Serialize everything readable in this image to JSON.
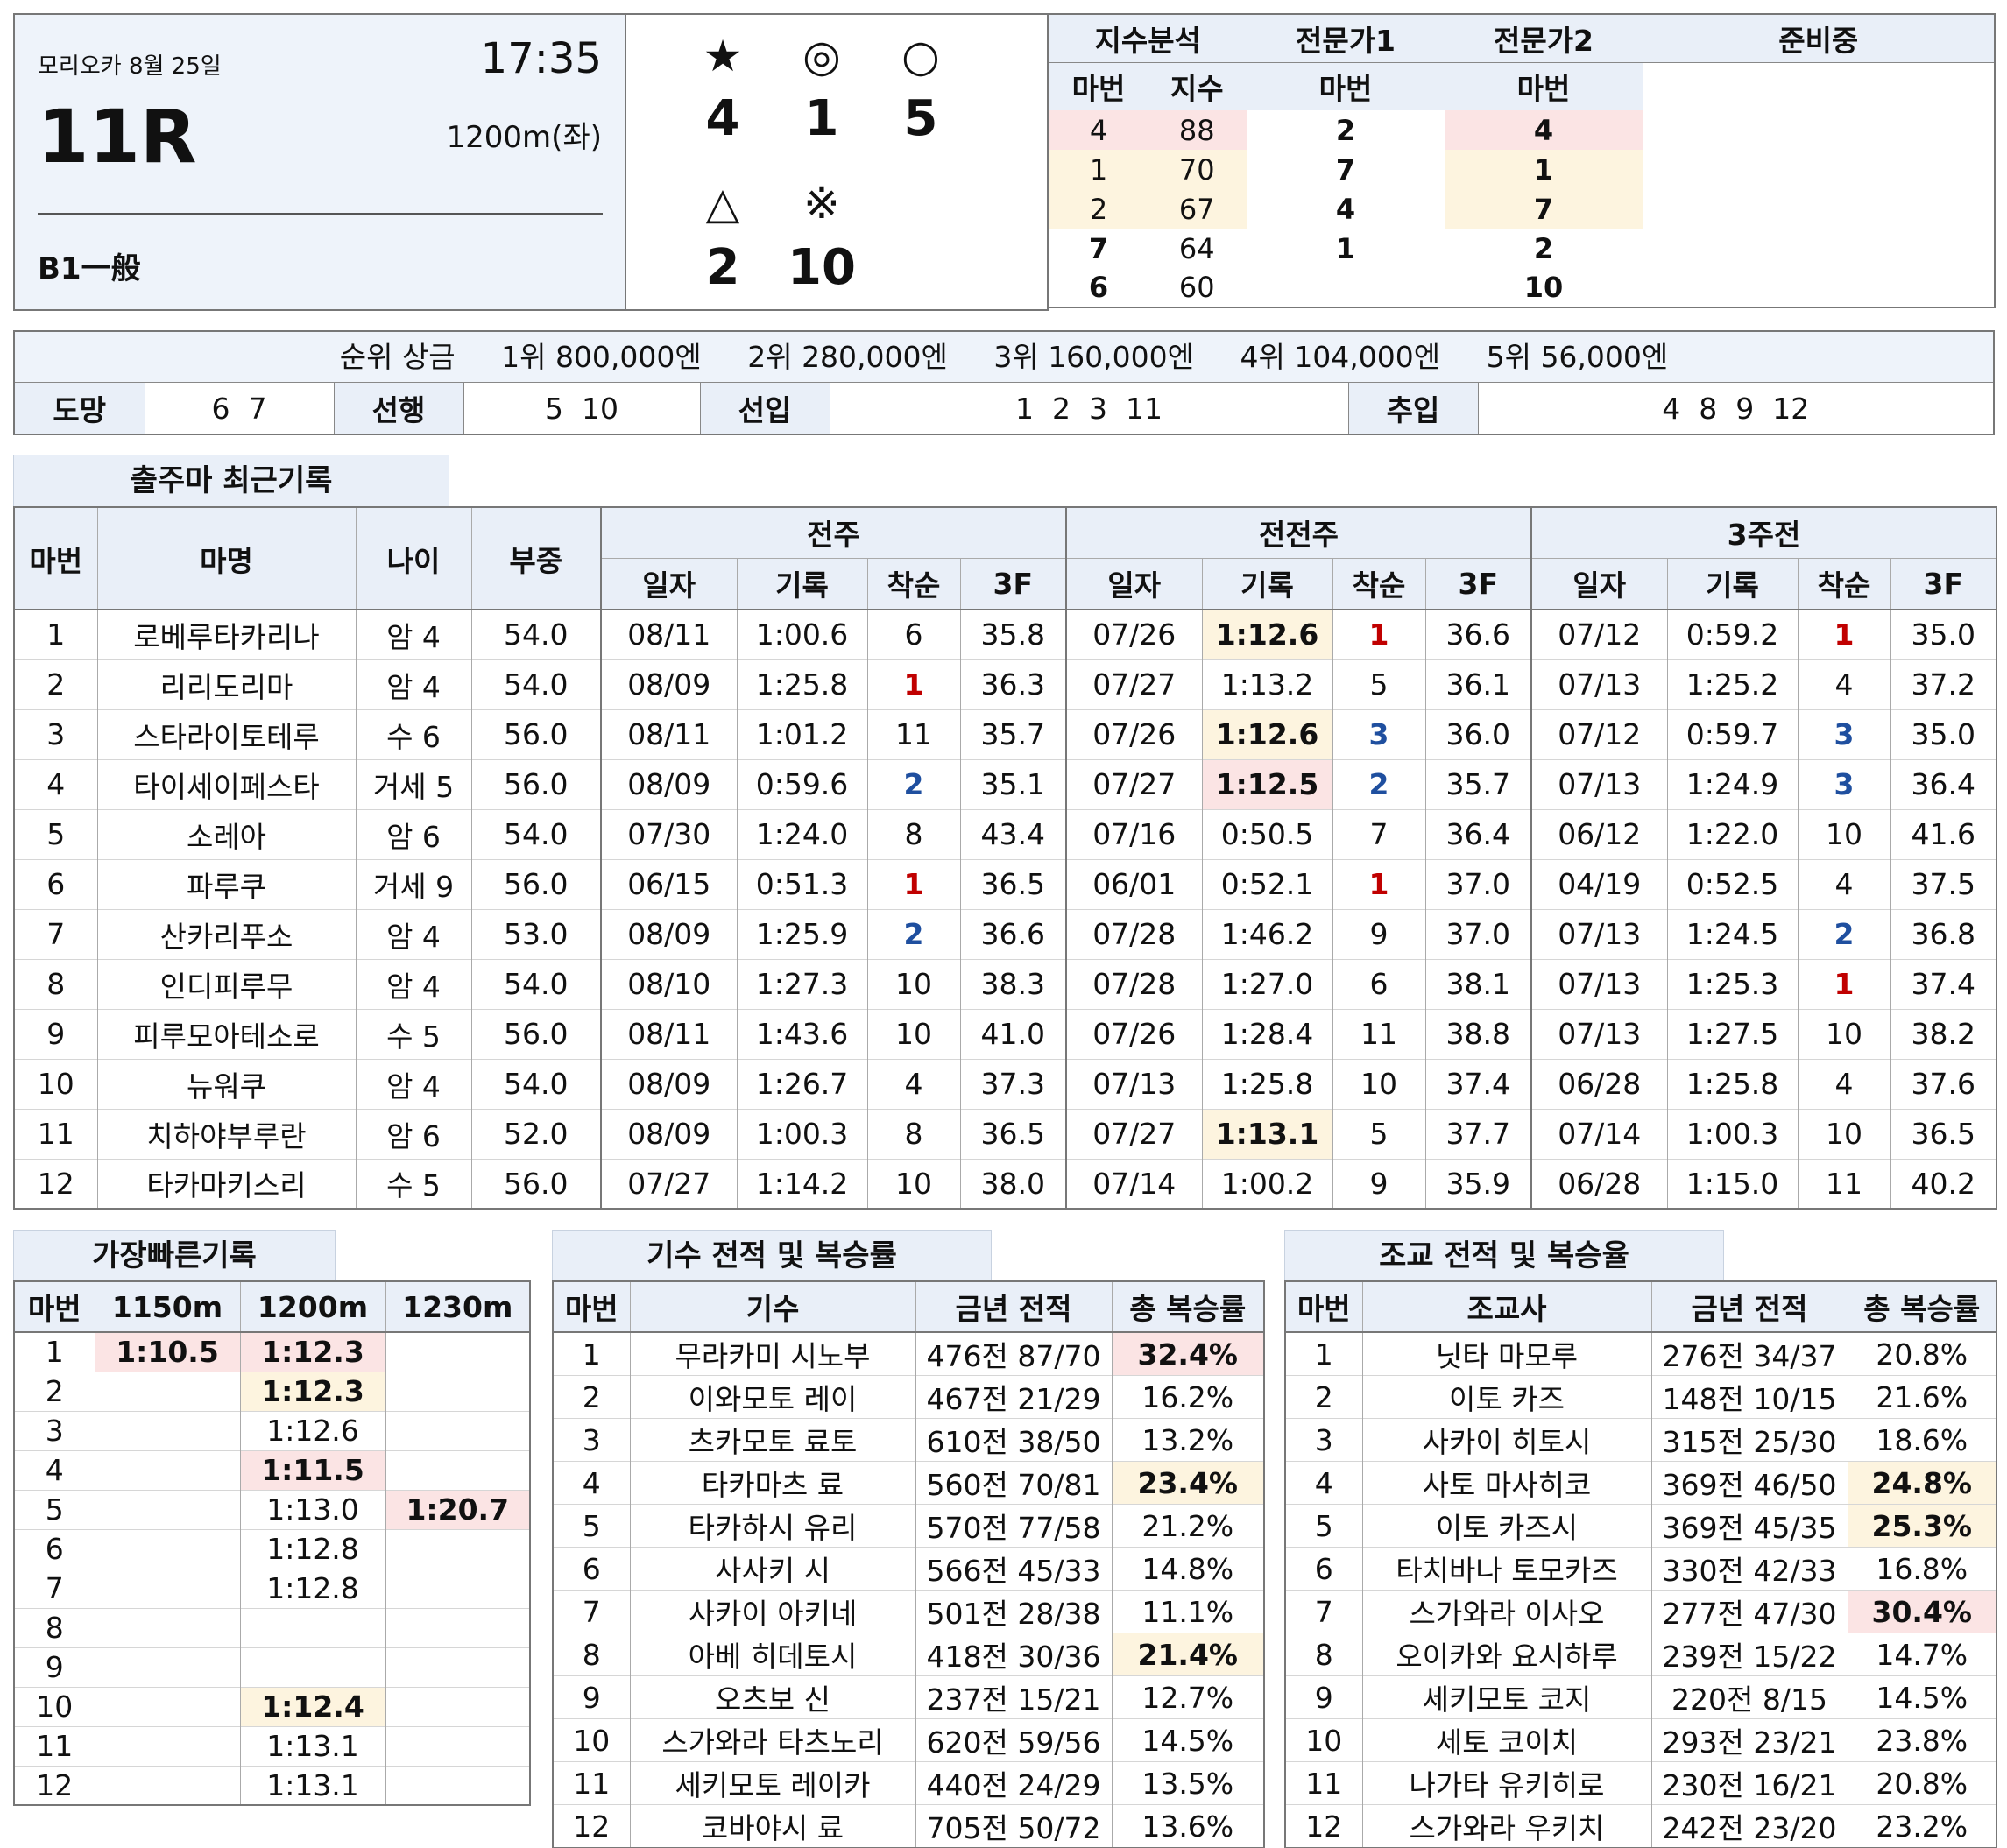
{
  "race": {
    "venue_date": "모리오카 8월 25일",
    "time": "17:35",
    "number": "11R",
    "distance": "1200m(좌)",
    "class": "B1一般"
  },
  "prediction": {
    "symbols": [
      "★",
      "◎",
      "○",
      "△",
      "※"
    ],
    "numbers": [
      "4",
      "1",
      "5",
      "2",
      "10"
    ]
  },
  "index_panel": {
    "headers": {
      "index_analysis": "지수분석",
      "expert1": "전문가1",
      "expert2": "전문가2",
      "preparing": "준비중"
    },
    "subheaders": {
      "horse_no": "마번",
      "index": "지수",
      "expert1_no": "마번",
      "expert2_no": "마번"
    },
    "rows": [
      {
        "no": "4",
        "idx": "88",
        "e1": "2",
        "e2": "4"
      },
      {
        "no": "1",
        "idx": "70",
        "e1": "7",
        "e2": "1"
      },
      {
        "no": "2",
        "idx": "67",
        "e1": "4",
        "e2": "7"
      },
      {
        "no": "7",
        "idx": "64",
        "e1": "1",
        "e2": "2"
      },
      {
        "no": "6",
        "idx": "60",
        "e1": "",
        "e2": "10"
      }
    ]
  },
  "prize": {
    "label": "순위 상금",
    "items": [
      "1위 800,000엔",
      "2위 280,000엔",
      "3위 160,000엔",
      "4위 104,000엔",
      "5위 56,000엔"
    ]
  },
  "running_style": {
    "escape_label": "도망",
    "escape": "6  7",
    "front_label": "선행",
    "front": "5  10",
    "stalker_label": "선입",
    "stalker": "1  2  3  11",
    "closer_label": "추입",
    "closer": "4  8  9  12"
  },
  "recent": {
    "title": "출주마 최근기록",
    "col_no": "마번",
    "col_name": "마명",
    "col_age": "나이",
    "col_weight": "부중",
    "groups": [
      "전주",
      "전전주",
      "3주전"
    ],
    "sub": [
      "일자",
      "기록",
      "착순",
      "3F"
    ],
    "rows": [
      {
        "no": "1",
        "name": "로베루타카리나",
        "age": "암 4",
        "wt": "54.0",
        "r": [
          [
            "08/11",
            "1:00.6",
            "6",
            "35.8"
          ],
          [
            "07/26",
            "1:12.6",
            "1",
            "36.6"
          ],
          [
            "07/12",
            "0:59.2",
            "1",
            "35.0"
          ]
        ]
      },
      {
        "no": "2",
        "name": "리리도리마",
        "age": "암 4",
        "wt": "54.0",
        "r": [
          [
            "08/09",
            "1:25.8",
            "1",
            "36.3"
          ],
          [
            "07/27",
            "1:13.2",
            "5",
            "36.1"
          ],
          [
            "07/13",
            "1:25.2",
            "4",
            "37.2"
          ]
        ]
      },
      {
        "no": "3",
        "name": "스타라이토테루",
        "age": "수 6",
        "wt": "56.0",
        "r": [
          [
            "08/11",
            "1:01.2",
            "11",
            "35.7"
          ],
          [
            "07/26",
            "1:12.6",
            "3",
            "36.0"
          ],
          [
            "07/12",
            "0:59.7",
            "3",
            "35.0"
          ]
        ]
      },
      {
        "no": "4",
        "name": "타이세이페스타",
        "age": "거세 5",
        "wt": "56.0",
        "r": [
          [
            "08/09",
            "0:59.6",
            "2",
            "35.1"
          ],
          [
            "07/27",
            "1:12.5",
            "2",
            "35.7"
          ],
          [
            "07/13",
            "1:24.9",
            "3",
            "36.4"
          ]
        ]
      },
      {
        "no": "5",
        "name": "소레아",
        "age": "암 6",
        "wt": "54.0",
        "r": [
          [
            "07/30",
            "1:24.0",
            "8",
            "43.4"
          ],
          [
            "07/16",
            "0:50.5",
            "7",
            "36.4"
          ],
          [
            "06/12",
            "1:22.0",
            "10",
            "41.6"
          ]
        ]
      },
      {
        "no": "6",
        "name": "파루쿠",
        "age": "거세 9",
        "wt": "56.0",
        "r": [
          [
            "06/15",
            "0:51.3",
            "1",
            "36.5"
          ],
          [
            "06/01",
            "0:52.1",
            "1",
            "37.0"
          ],
          [
            "04/19",
            "0:52.5",
            "4",
            "37.5"
          ]
        ]
      },
      {
        "no": "7",
        "name": "산카리푸소",
        "age": "암 4",
        "wt": "53.0",
        "r": [
          [
            "08/09",
            "1:25.9",
            "2",
            "36.6"
          ],
          [
            "07/28",
            "1:46.2",
            "9",
            "37.0"
          ],
          [
            "07/13",
            "1:24.5",
            "2",
            "36.8"
          ]
        ]
      },
      {
        "no": "8",
        "name": "인디피루무",
        "age": "암 4",
        "wt": "54.0",
        "r": [
          [
            "08/10",
            "1:27.3",
            "10",
            "38.3"
          ],
          [
            "07/28",
            "1:27.0",
            "6",
            "38.1"
          ],
          [
            "07/13",
            "1:25.3",
            "1",
            "37.4"
          ]
        ]
      },
      {
        "no": "9",
        "name": "피루모아테소로",
        "age": "수 5",
        "wt": "56.0",
        "r": [
          [
            "08/11",
            "1:43.6",
            "10",
            "41.0"
          ],
          [
            "07/26",
            "1:28.4",
            "11",
            "38.8"
          ],
          [
            "07/13",
            "1:27.5",
            "10",
            "38.2"
          ]
        ]
      },
      {
        "no": "10",
        "name": "뉴워쿠",
        "age": "암 4",
        "wt": "54.0",
        "r": [
          [
            "08/09",
            "1:26.7",
            "4",
            "37.3"
          ],
          [
            "07/13",
            "1:25.8",
            "10",
            "37.4"
          ],
          [
            "06/28",
            "1:25.8",
            "4",
            "37.6"
          ]
        ]
      },
      {
        "no": "11",
        "name": "치하야부루란",
        "age": "암 6",
        "wt": "52.0",
        "r": [
          [
            "08/09",
            "1:00.3",
            "8",
            "36.5"
          ],
          [
            "07/27",
            "1:13.1",
            "5",
            "37.7"
          ],
          [
            "07/14",
            "1:00.3",
            "10",
            "36.5"
          ]
        ]
      },
      {
        "no": "12",
        "name": "타카마키스리",
        "age": "수 5",
        "wt": "56.0",
        "r": [
          [
            "07/27",
            "1:14.2",
            "10",
            "38.0"
          ],
          [
            "07/14",
            "1:00.2",
            "9",
            "35.9"
          ],
          [
            "06/28",
            "1:15.0",
            "11",
            "40.2"
          ]
        ]
      }
    ]
  },
  "fastest": {
    "title": "가장빠른기록",
    "headers": [
      "마번",
      "1150m",
      "1200m",
      "1230m"
    ],
    "rows": [
      [
        "1",
        "1:10.5",
        "1:12.3",
        ""
      ],
      [
        "2",
        "",
        "1:12.3",
        ""
      ],
      [
        "3",
        "",
        "1:12.6",
        ""
      ],
      [
        "4",
        "",
        "1:11.5",
        ""
      ],
      [
        "5",
        "",
        "1:13.0",
        "1:20.7"
      ],
      [
        "6",
        "",
        "1:12.8",
        ""
      ],
      [
        "7",
        "",
        "1:12.8",
        ""
      ],
      [
        "8",
        "",
        "",
        ""
      ],
      [
        "9",
        "",
        "",
        ""
      ],
      [
        "10",
        "",
        "1:12.4",
        ""
      ],
      [
        "11",
        "",
        "1:13.1",
        ""
      ],
      [
        "12",
        "",
        "1:13.1",
        ""
      ]
    ]
  },
  "jockey": {
    "title": "기수 전적 및 복승률",
    "headers": [
      "마번",
      "기수",
      "금년 전적",
      "총 복승률"
    ],
    "rows": [
      [
        "1",
        "무라카미 시노부",
        "476전 87/70",
        "32.4%"
      ],
      [
        "2",
        "이와모토 레이",
        "467전 21/29",
        "16.2%"
      ],
      [
        "3",
        "츠카모토 료토",
        "610전 38/50",
        "13.2%"
      ],
      [
        "4",
        "타카마츠 료",
        "560전 70/81",
        "23.4%"
      ],
      [
        "5",
        "타카하시 유리",
        "570전 77/58",
        "21.2%"
      ],
      [
        "6",
        "사사키 시",
        "566전 45/33",
        "14.8%"
      ],
      [
        "7",
        "사카이 아키네",
        "501전 28/38",
        "11.1%"
      ],
      [
        "8",
        "아베 히데토시",
        "418전 30/36",
        "21.4%"
      ],
      [
        "9",
        "오츠보 신",
        "237전 15/21",
        "12.7%"
      ],
      [
        "10",
        "스가와라 타츠노리",
        "620전 59/56",
        "14.5%"
      ],
      [
        "11",
        "세키모토 레이카",
        "440전 24/29",
        "13.5%"
      ],
      [
        "12",
        "코바야시 료",
        "705전 50/72",
        "13.6%"
      ]
    ]
  },
  "trainer": {
    "title": "조교 전적 및 복승율",
    "headers": [
      "마번",
      "조교사",
      "금년 전적",
      "총 복승률"
    ],
    "rows": [
      [
        "1",
        "닛타 마모루",
        "276전 34/37",
        "20.8%"
      ],
      [
        "2",
        "이토 카즈",
        "148전 10/15",
        "21.6%"
      ],
      [
        "3",
        "사카이 히토시",
        "315전 25/30",
        "18.6%"
      ],
      [
        "4",
        "사토 마사히코",
        "369전 46/50",
        "24.8%"
      ],
      [
        "5",
        "이토 카즈시",
        "369전 45/35",
        "25.3%"
      ],
      [
        "6",
        "타치바나 토모카즈",
        "330전 42/33",
        "16.8%"
      ],
      [
        "7",
        "스가와라 이사오",
        "277전 47/30",
        "30.4%"
      ],
      [
        "8",
        "오이카와 요시하루",
        "239전 15/22",
        "14.7%"
      ],
      [
        "9",
        "세키모토 코지",
        "220전 8/15",
        "14.5%"
      ],
      [
        "10",
        "세토 코이치",
        "293전 23/21",
        "23.8%"
      ],
      [
        "11",
        "나가타 유키히로",
        "230전 16/21",
        "20.8%"
      ],
      [
        "12",
        "스가와라 우키치",
        "242전 23/20",
        "23.2%"
      ]
    ]
  },
  "colors": {
    "header_bg": "#e9eff8",
    "highlight_pink": "#fbe4e4",
    "highlight_yellow": "#fdf4df",
    "rank1_red": "#c00000",
    "rank23_blue": "#1f4f9f"
  }
}
